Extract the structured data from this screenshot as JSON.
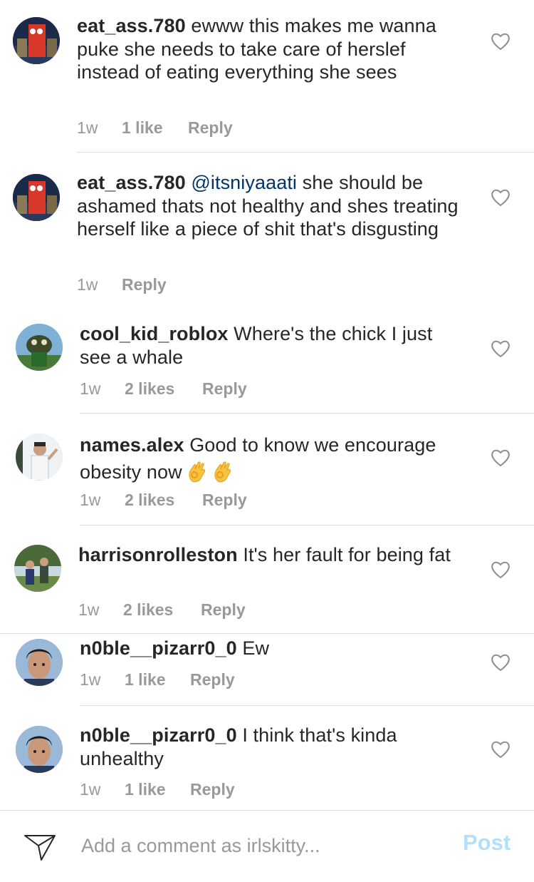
{
  "comments": [
    {
      "username": "eat_ass.780",
      "mention": "",
      "text": " ewww this makes me wanna puke she needs to take care of herslef instead of eating everything she sees",
      "time": "1w",
      "likes": "1 like",
      "reply": "Reply"
    },
    {
      "username": "eat_ass.780",
      "mention": "@itsniyaaati",
      "text": " she should be ashamed thats not healthy and shes treating herself like a piece of shit that's disgusting",
      "time": "1w",
      "likes": "",
      "reply": "Reply"
    },
    {
      "username": "cool_kid_roblox",
      "mention": "",
      "text": " Where's the chick I just see a whale",
      "time": "1w",
      "likes": "2 likes",
      "reply": "Reply"
    },
    {
      "username": "names.alex",
      "mention": "",
      "text": " Good to know we encourage obesity now",
      "emoji": "ok-hand-emoji",
      "time": "1w",
      "likes": "2 likes",
      "reply": "Reply"
    },
    {
      "username": "harrisonrolleston",
      "mention": "",
      "text": " It's her fault for being fat",
      "time": "1w",
      "likes": "2 likes",
      "reply": "Reply"
    },
    {
      "username": "n0ble__pizarr0_0",
      "mention": "",
      "text": " Ew",
      "time": "1w",
      "likes": "1 like",
      "reply": "Reply"
    },
    {
      "username": "n0ble__pizarr0_0",
      "mention": "",
      "text": " I think that's kinda unhealthy",
      "time": "1w",
      "likes": "1 like",
      "reply": "Reply"
    }
  ],
  "composer": {
    "placeholder": "Add a comment as irlskitty...",
    "post_label": "Post",
    "icon": "send-icon"
  },
  "colors": {
    "text": "#262626",
    "meta": "#999999",
    "mention": "#003569",
    "post_disabled": "#b2dffc",
    "divider": "#dbdbdb"
  }
}
